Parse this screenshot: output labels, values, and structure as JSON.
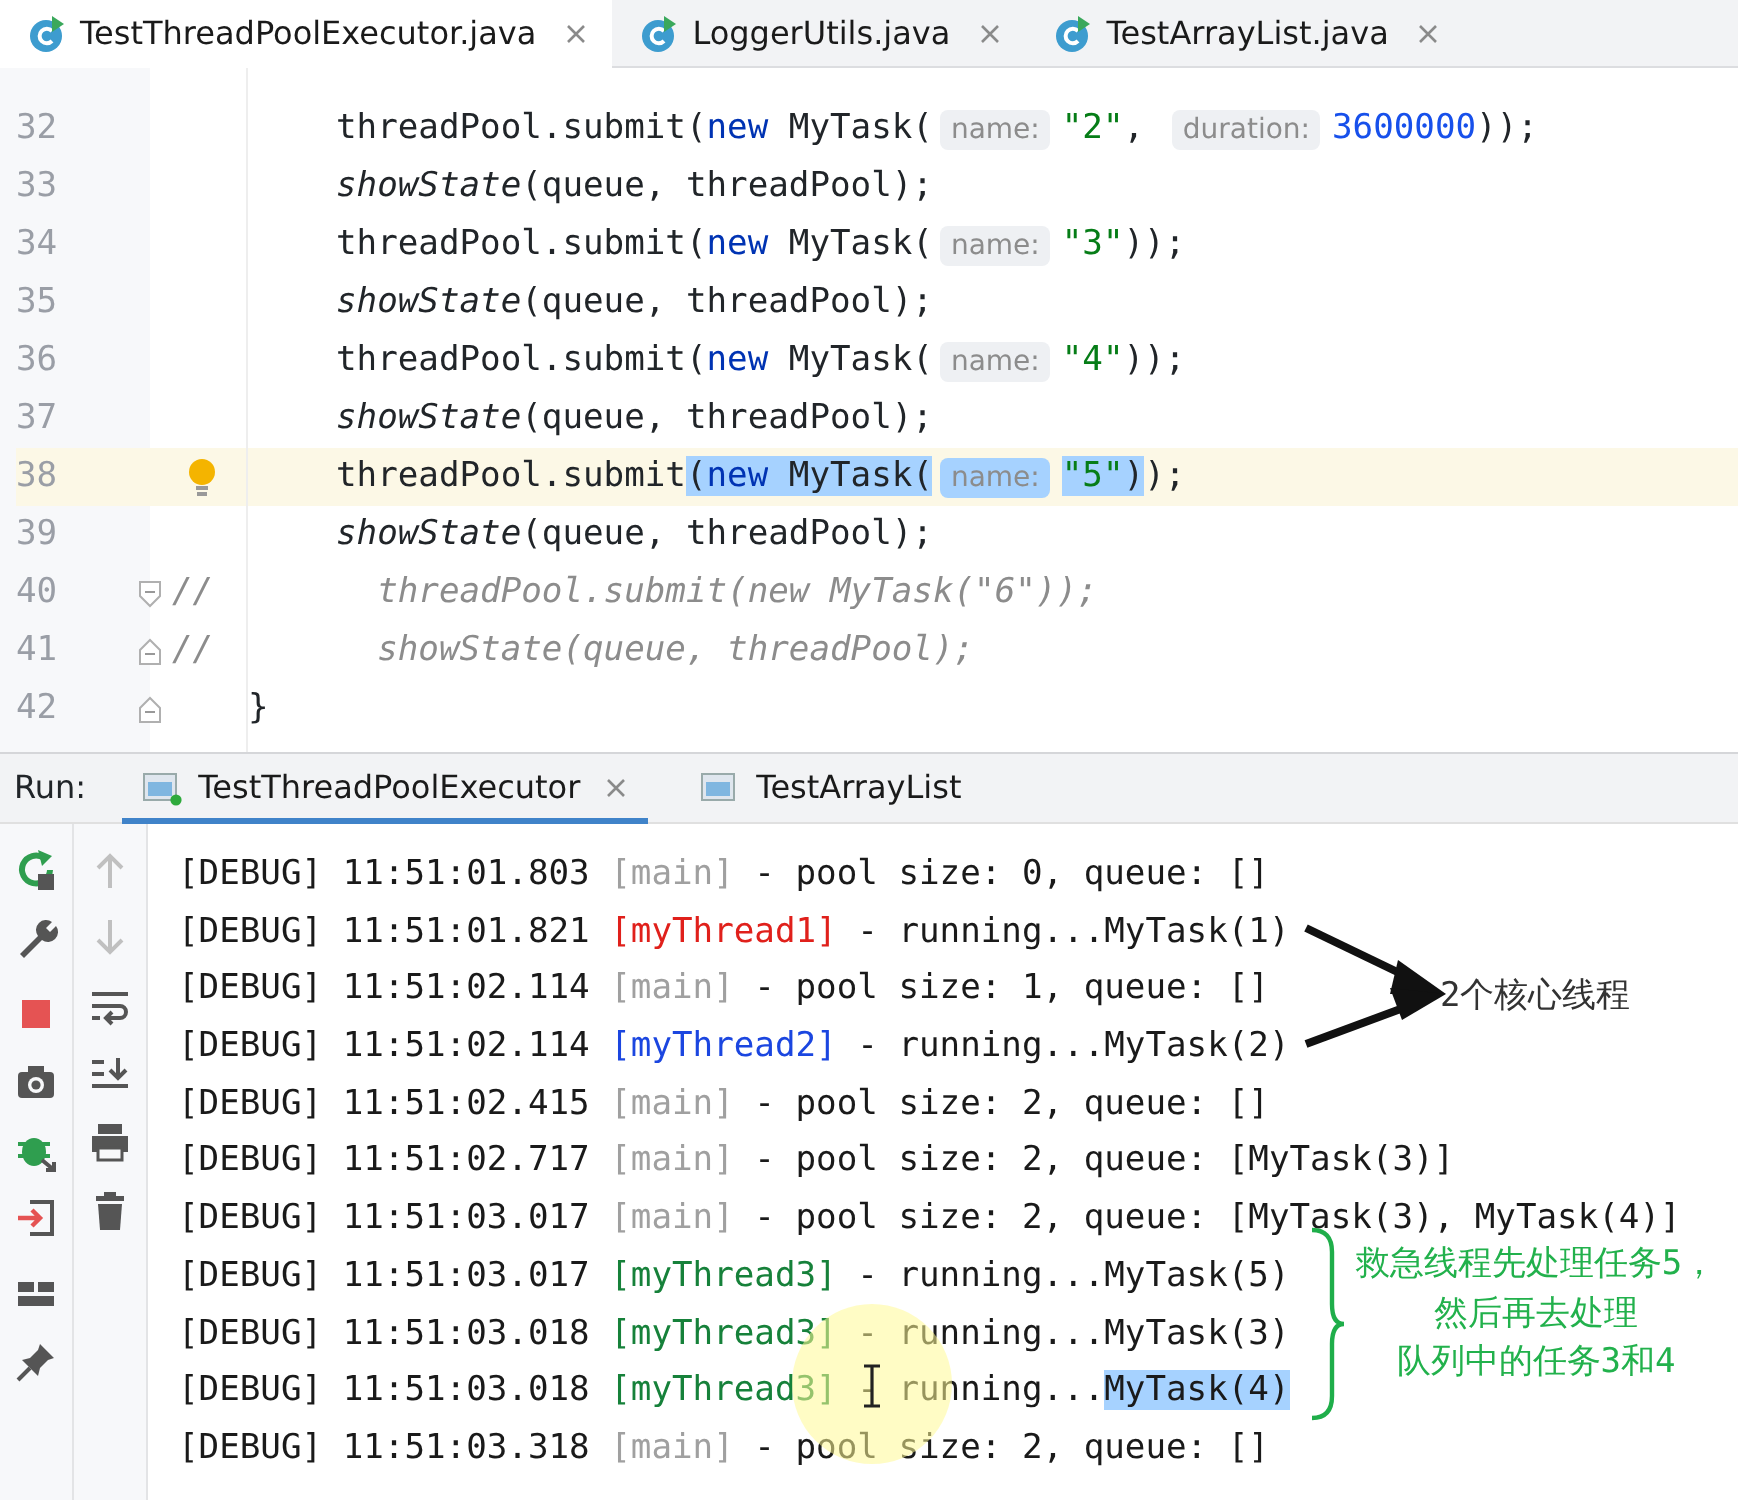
{
  "editor_tabs": [
    {
      "label": "TestThreadPoolExecutor.java",
      "selected": true
    },
    {
      "label": "LoggerUtils.java",
      "selected": false
    },
    {
      "label": "TestArrayList.java",
      "selected": false
    }
  ],
  "code_lines": [
    {
      "number": "32",
      "kind": "body",
      "current": false,
      "tokens": [
        {
          "kind": "plain",
          "text": "threadPool.submit("
        },
        {
          "kind": "keyword",
          "text": "new"
        },
        {
          "kind": "plain",
          "text": " MyTask("
        },
        {
          "kind": "hint",
          "text": "name:"
        },
        {
          "kind": "string",
          "text": "\"2\""
        },
        {
          "kind": "plain",
          "text": ", "
        },
        {
          "kind": "hint",
          "text": "duration:"
        },
        {
          "kind": "number",
          "text": "3600000"
        },
        {
          "kind": "plain",
          "text": "));"
        }
      ]
    },
    {
      "number": "33",
      "kind": "body",
      "current": false,
      "tokens": [
        {
          "kind": "method",
          "text": "showState"
        },
        {
          "kind": "plain",
          "text": "(queue, threadPool);"
        }
      ]
    },
    {
      "number": "34",
      "kind": "body",
      "current": false,
      "tokens": [
        {
          "kind": "plain",
          "text": "threadPool.submit("
        },
        {
          "kind": "keyword",
          "text": "new"
        },
        {
          "kind": "plain",
          "text": " MyTask("
        },
        {
          "kind": "hint",
          "text": "name:"
        },
        {
          "kind": "string",
          "text": "\"3\""
        },
        {
          "kind": "plain",
          "text": "));"
        }
      ]
    },
    {
      "number": "35",
      "kind": "body",
      "current": false,
      "tokens": [
        {
          "kind": "method",
          "text": "showState"
        },
        {
          "kind": "plain",
          "text": "(queue, threadPool);"
        }
      ]
    },
    {
      "number": "36",
      "kind": "body",
      "current": false,
      "tokens": [
        {
          "kind": "plain",
          "text": "threadPool.submit("
        },
        {
          "kind": "keyword",
          "text": "new"
        },
        {
          "kind": "plain",
          "text": " MyTask("
        },
        {
          "kind": "hint",
          "text": "name:"
        },
        {
          "kind": "string",
          "text": "\"4\""
        },
        {
          "kind": "plain",
          "text": "));"
        }
      ]
    },
    {
      "number": "37",
      "kind": "body",
      "current": false,
      "tokens": [
        {
          "kind": "method",
          "text": "showState"
        },
        {
          "kind": "plain",
          "text": "(queue, threadPool);"
        }
      ]
    },
    {
      "number": "38",
      "kind": "body",
      "current": true,
      "bulb": true,
      "tokens": [
        {
          "kind": "plain",
          "text": "threadPool.submit"
        },
        {
          "kind": "plain",
          "text": "(",
          "selected": true
        },
        {
          "kind": "keyword",
          "text": "new",
          "selected": true
        },
        {
          "kind": "plain",
          "text": " MyTask(",
          "selected": true
        },
        {
          "kind": "hint",
          "text": "name:",
          "selected": true
        },
        {
          "kind": "string",
          "text": "\"5\"",
          "selected": true
        },
        {
          "kind": "plain",
          "text": ")",
          "selected": true
        },
        {
          "kind": "plain",
          "text": ");"
        }
      ]
    },
    {
      "number": "39",
      "kind": "body",
      "current": false,
      "tokens": [
        {
          "kind": "method",
          "text": "showState"
        },
        {
          "kind": "plain",
          "text": "(queue, threadPool);"
        }
      ]
    },
    {
      "number": "40",
      "kind": "commented",
      "current": false,
      "fold_start": true,
      "tokens": [
        {
          "kind": "comment_mark",
          "text": "//"
        },
        {
          "kind": "comment",
          "text": "threadPool.submit(new MyTask(\"6\"));"
        }
      ]
    },
    {
      "number": "41",
      "kind": "commented",
      "current": false,
      "fold_end": true,
      "tokens": [
        {
          "kind": "comment_mark",
          "text": "//"
        },
        {
          "kind": "comment",
          "text": "showState(queue, threadPool);"
        }
      ]
    },
    {
      "number": "42",
      "kind": "close",
      "current": false,
      "fold_end": true,
      "tokens": [
        {
          "kind": "plain",
          "text": "}"
        }
      ]
    }
  ],
  "run_bar": {
    "label": "Run:",
    "tabs": [
      {
        "label": "TestThreadPoolExecutor",
        "selected": true,
        "running": true
      },
      {
        "label": "TestArrayList",
        "selected": false,
        "running": false
      }
    ]
  },
  "console_lines": [
    {
      "level": "[DEBUG]",
      "time": "11:51:01.803",
      "thread": {
        "text": "[main]",
        "color": "#a0a0a0"
      },
      "message": [
        {
          "text": "- pool size: 0, queue: []",
          "selected": false
        }
      ]
    },
    {
      "level": "[DEBUG]",
      "time": "11:51:01.821",
      "thread": {
        "text": "[myThread1]",
        "color": "#e0201b"
      },
      "message": [
        {
          "text": "- running...MyTask(1)",
          "selected": false
        }
      ]
    },
    {
      "level": "[DEBUG]",
      "time": "11:51:02.114",
      "thread": {
        "text": "[main]",
        "color": "#a0a0a0"
      },
      "message": [
        {
          "text": "- pool size: 1, queue: []",
          "selected": false
        }
      ]
    },
    {
      "level": "[DEBUG]",
      "time": "11:51:02.114",
      "thread": {
        "text": "[myThread2]",
        "color": "#1b46e0"
      },
      "message": [
        {
          "text": "- running...MyTask(2)",
          "selected": false
        }
      ]
    },
    {
      "level": "[DEBUG]",
      "time": "11:51:02.415",
      "thread": {
        "text": "[main]",
        "color": "#a0a0a0"
      },
      "message": [
        {
          "text": "- pool size: 2, queue: []",
          "selected": false
        }
      ]
    },
    {
      "level": "[DEBUG]",
      "time": "11:51:02.717",
      "thread": {
        "text": "[main]",
        "color": "#a0a0a0"
      },
      "message": [
        {
          "text": "- pool size: 2, queue: [MyTask(3)]",
          "selected": false
        }
      ]
    },
    {
      "level": "[DEBUG]",
      "time": "11:51:03.017",
      "thread": {
        "text": "[main]",
        "color": "#a0a0a0"
      },
      "message": [
        {
          "text": "- pool size: 2, queue: [MyTask(3), MyTask(4)]",
          "selected": false
        }
      ]
    },
    {
      "level": "[DEBUG]",
      "time": "11:51:03.017",
      "thread": {
        "text": "[myThread3]",
        "color": "#16813a"
      },
      "message": [
        {
          "text": "- running...MyTask(5)",
          "selected": false
        }
      ]
    },
    {
      "level": "[DEBUG]",
      "time": "11:51:03.018",
      "thread": {
        "text": "[myThread3]",
        "color": "#16813a"
      },
      "message": [
        {
          "text": "- running...MyTask(3)",
          "selected": false
        }
      ]
    },
    {
      "level": "[DEBUG]",
      "time": "11:51:03.018",
      "thread": {
        "text": "[myThread3]",
        "color": "#16813a"
      },
      "message": [
        {
          "text": "- running...",
          "selected": false
        },
        {
          "text": "MyTask(4)",
          "selected": true
        }
      ]
    },
    {
      "level": "[DEBUG]",
      "time": "11:51:03.318",
      "thread": {
        "text": "[main]",
        "color": "#a0a0a0"
      },
      "message": [
        {
          "text": "- pool size: 2, queue: []",
          "selected": false
        }
      ]
    }
  ],
  "annotations": [
    {
      "kind": "arrows",
      "text": [
        "2个核心线程"
      ]
    },
    {
      "kind": "brace",
      "text": [
        "救急线程先处理任务5，",
        "然后再去处理",
        "队列中的任务3和4"
      ]
    }
  ]
}
